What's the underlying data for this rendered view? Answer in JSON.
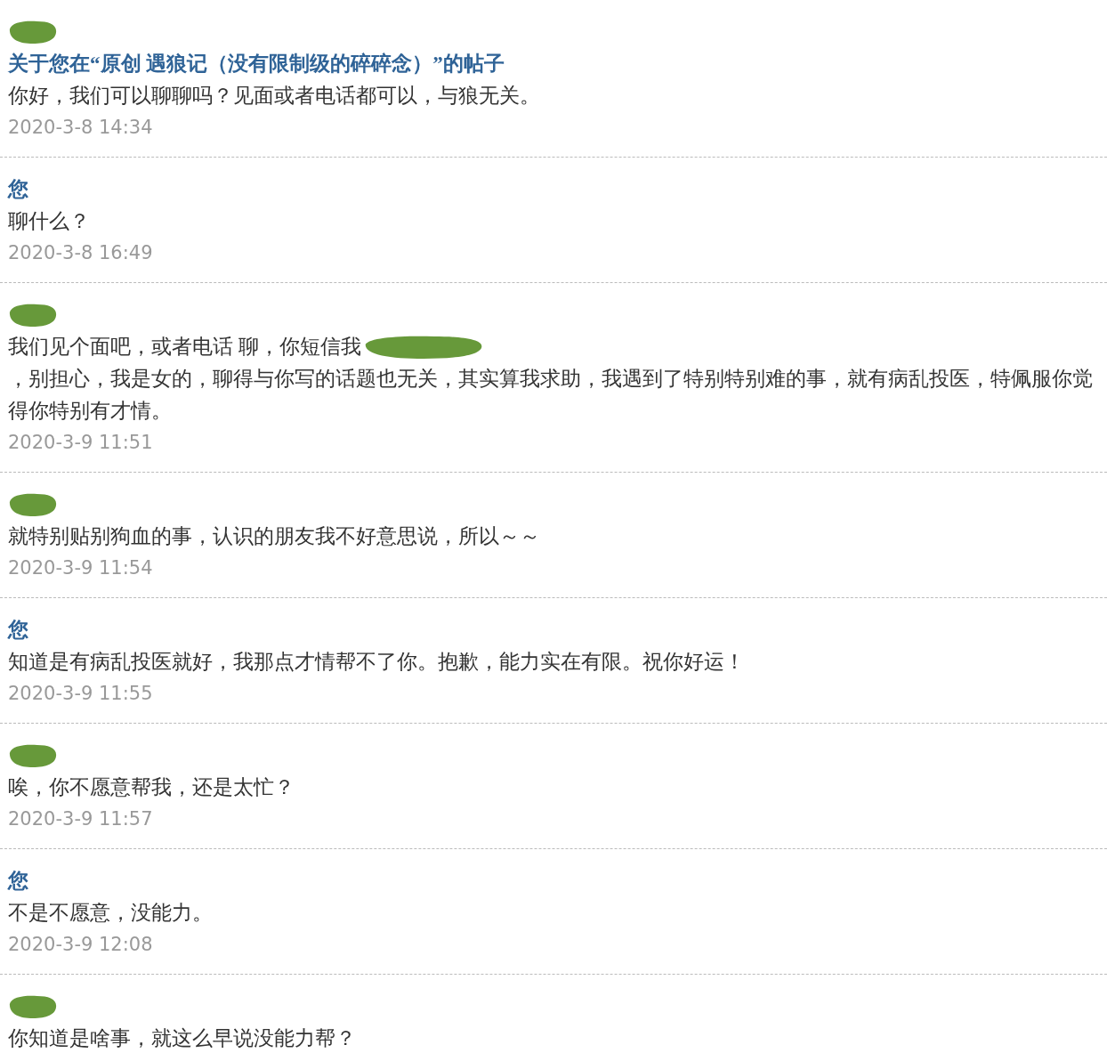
{
  "messages": [
    {
      "sender": {
        "kind": "redacted"
      },
      "subject": "关于您在“原创 遇狼记（没有限制级的碎碎念）”的帖子",
      "body": [
        {
          "kind": "text",
          "text": "你好，我们可以聊聊吗？见面或者电话都可以，与狼无关。"
        }
      ],
      "time": "2020-3-8 14:34"
    },
    {
      "sender": {
        "kind": "name",
        "text": "您"
      },
      "body": [
        {
          "kind": "text",
          "text": "聊什么？"
        }
      ],
      "time": "2020-3-8 16:49"
    },
    {
      "sender": {
        "kind": "redacted"
      },
      "body": [
        {
          "kind": "text",
          "text": "我们见个面吧，或者电话 聊，你短信我"
        },
        {
          "kind": "redaction"
        },
        {
          "kind": "text",
          "text": "，别担心，我是女的，聊得与你写的话题也无关，其实算我求助，我遇到了特别特别难的事，就有病乱投医，特佩服你觉得你特别有才情。"
        }
      ],
      "time": "2020-3-9 11:51"
    },
    {
      "sender": {
        "kind": "redacted"
      },
      "body": [
        {
          "kind": "text",
          "text": "就特别贴别狗血的事，认识的朋友我不好意思说，所以～～"
        }
      ],
      "time": "2020-3-9 11:54"
    },
    {
      "sender": {
        "kind": "name",
        "text": "您"
      },
      "body": [
        {
          "kind": "text",
          "text": "知道是有病乱投医就好，我那点才情帮不了你。抱歉，能力实在有限。祝你好运！"
        }
      ],
      "time": "2020-3-9 11:55"
    },
    {
      "sender": {
        "kind": "redacted"
      },
      "body": [
        {
          "kind": "text",
          "text": "唉，你不愿意帮我，还是太忙？"
        }
      ],
      "time": "2020-3-9 11:57"
    },
    {
      "sender": {
        "kind": "name",
        "text": "您"
      },
      "body": [
        {
          "kind": "text",
          "text": "不是不愿意，没能力。"
        }
      ],
      "time": "2020-3-9 12:08"
    },
    {
      "sender": {
        "kind": "redacted"
      },
      "body": [
        {
          "kind": "text",
          "text": "你知道是啥事，就这么早说没能力帮？"
        }
      ]
    }
  ]
}
